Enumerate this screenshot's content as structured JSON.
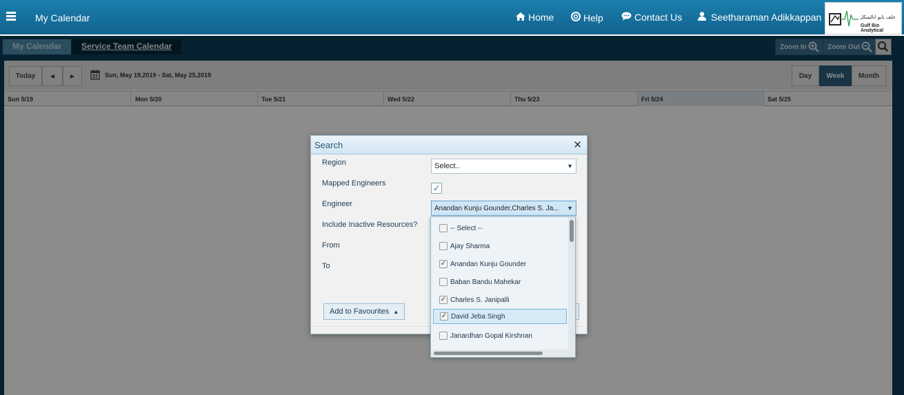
{
  "header": {
    "title": "My Calendar",
    "nav": [
      {
        "label": "Home",
        "icon": "home-icon"
      },
      {
        "label": "Help",
        "icon": "help-icon"
      },
      {
        "label": "Contact Us",
        "icon": "chat-icon"
      }
    ],
    "user": "Seetharaman Adikkappan",
    "logo": {
      "arabic": "جلف بايو اناليتيكل",
      "english": "Gulf Bio Analytical"
    }
  },
  "tabs": {
    "my_calendar": "My Calendar",
    "service_team": "Service Team Calendar"
  },
  "zoom": {
    "in": "Zoom In",
    "out": "Zoom Out"
  },
  "toolbar": {
    "today": "Today",
    "prev": "◀",
    "next": "▶",
    "date_range": "Sun, May 19,2019 - Sat, May 25,2019",
    "views": [
      "Day",
      "Week",
      "Month"
    ],
    "active_view": "Week"
  },
  "days": [
    "Sun 5/19",
    "Mon 5/20",
    "Tue 5/21",
    "Wed 5/22",
    "Thu 5/23",
    "Fri 5/24",
    "Sat 5/25"
  ],
  "dialog": {
    "title": "Search",
    "labels": {
      "region": "Region",
      "mapped": "Mapped Engineers",
      "engineer": "Engineer",
      "inactive": "Include Inactive Resources?",
      "from": "From",
      "to": "To"
    },
    "region_value": "Select..",
    "mapped_checked": true,
    "engineer_value": "Anandan Kunju Gounder,Charles S. Ja...",
    "favourites": "Add to Favourites",
    "options": [
      {
        "label": "-- Select --",
        "checked": false
      },
      {
        "label": "Ajay Sharma",
        "checked": false
      },
      {
        "label": "Anandan Kunju Gounder",
        "checked": true
      },
      {
        "label": "Baban Bandu Mahekar",
        "checked": false
      },
      {
        "label": "Charles S. Janipalli",
        "checked": true
      },
      {
        "label": "David Jeba Singh",
        "checked": true
      },
      {
        "label": "Janardhan Gopal Kirshnan",
        "checked": false
      }
    ]
  },
  "colors": {
    "header": "#1b7fad",
    "dark": "#0d3a55",
    "accent": "#2d5f7f"
  }
}
